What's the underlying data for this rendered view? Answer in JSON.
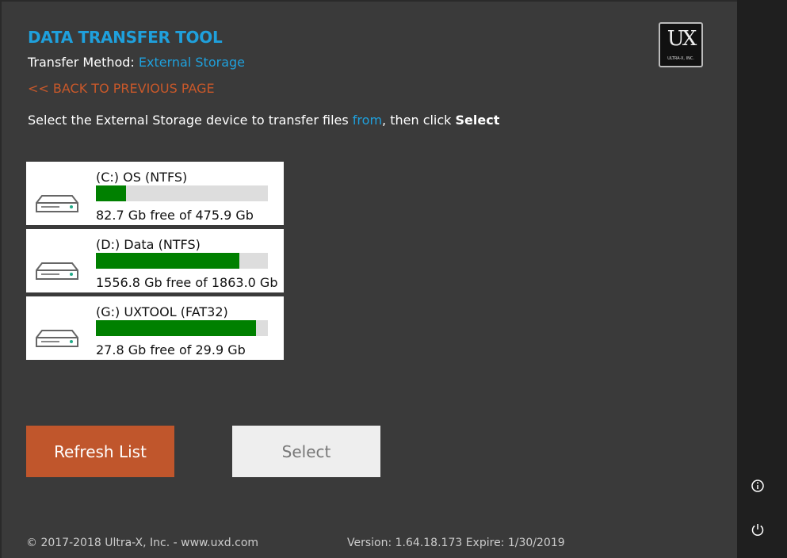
{
  "header": {
    "title": "DATA TRANSFER TOOL",
    "method_label": "Transfer Method:",
    "method_value": "External Storage",
    "back_link": "<< BACK TO PREVIOUS PAGE"
  },
  "instruction": {
    "prefix": "Select the External Storage device to transfer files ",
    "highlight": "from",
    "middle": ", then click ",
    "bold": "Select"
  },
  "logo": {
    "text": "UX",
    "subtext": "ULTRA-X, INC."
  },
  "drives": [
    {
      "name": "(C:) OS (NTFS)",
      "free_text": "82.7 Gb free of 475.9 Gb",
      "used_fraction": 0.174
    },
    {
      "name": "(D:) Data (NTFS)",
      "free_text": "1556.8 Gb free of 1863.0 Gb",
      "used_fraction": 0.836
    },
    {
      "name": "(G:) UXTOOL (FAT32)",
      "free_text": "27.8 Gb free of 29.9 Gb",
      "used_fraction": 0.93
    }
  ],
  "buttons": {
    "refresh": "Refresh List",
    "select": "Select"
  },
  "footer": {
    "copyright": "© 2017-2018 Ultra-X, Inc. - www.uxd.com",
    "version": "Version: 1.64.18.173 Expire: 1/30/2019"
  },
  "sidebar": {
    "icons": [
      "info-icon",
      "power-icon"
    ]
  },
  "colors": {
    "accent": "#1fa0dc",
    "warning": "#c0562c",
    "bar_fill": "#008000"
  }
}
